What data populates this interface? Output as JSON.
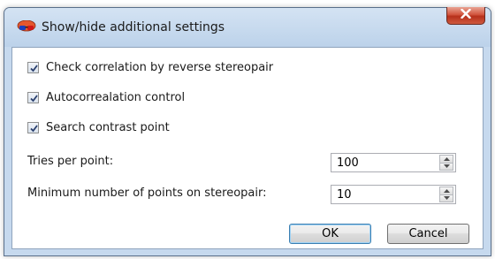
{
  "window": {
    "title": "Show/hide additional settings",
    "app_icon": "stereo-glasses-icon",
    "close_icon": "close-icon"
  },
  "options": [
    {
      "label": "Check correlation by reverse stereopair",
      "checked": true
    },
    {
      "label": "Autocorrealation control",
      "checked": true
    },
    {
      "label": "Search contrast point",
      "checked": true
    }
  ],
  "fields": {
    "tries_per_point": {
      "label": "Tries per point:",
      "value": "100"
    },
    "min_points": {
      "label": "Minimum number of points on stereopair:",
      "value": "10"
    }
  },
  "buttons": {
    "ok_label": "OK",
    "cancel_label": "Cancel"
  },
  "colors": {
    "titlebar": "#c6d9ee",
    "close_button": "#c9452e",
    "ok_focus": "#3c7fb1"
  }
}
